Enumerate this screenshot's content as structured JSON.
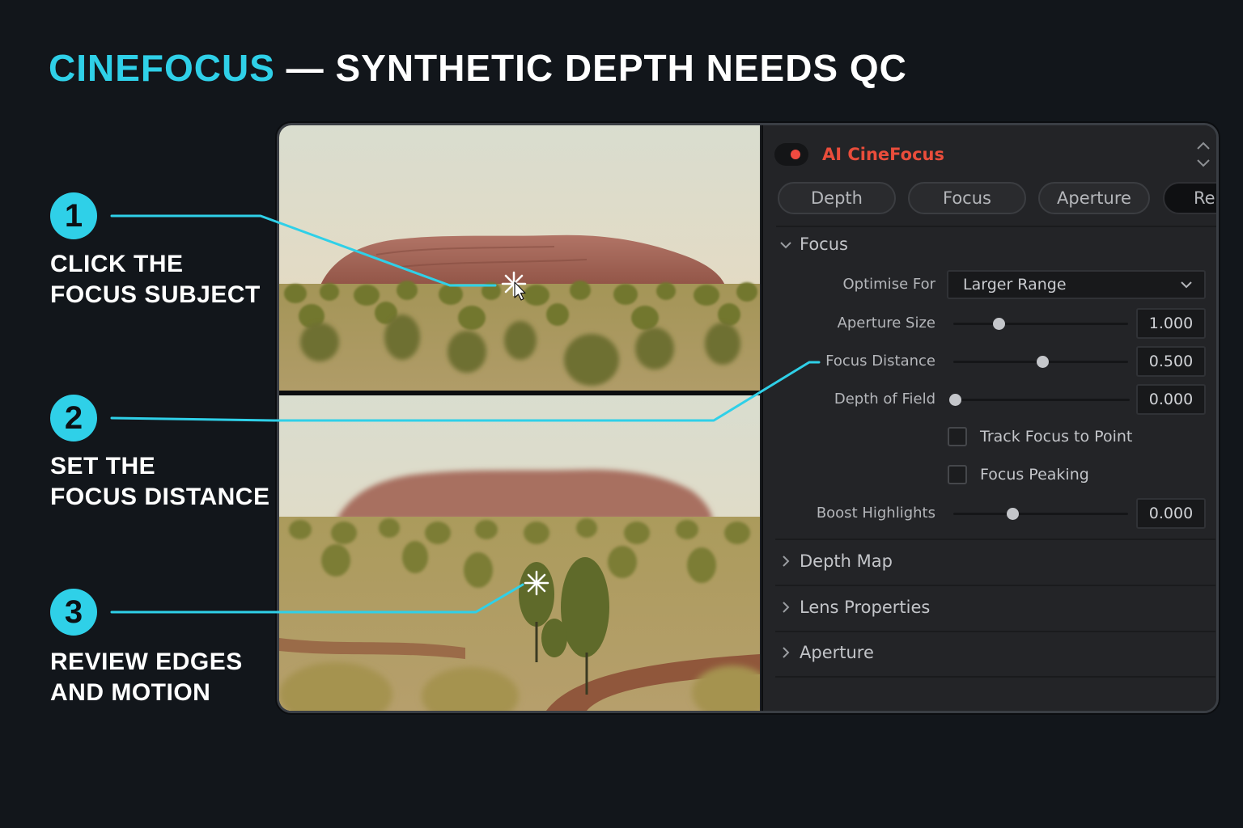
{
  "headline": {
    "brand": "CINEFOCUS",
    "rest": " — SYNTHETIC DEPTH NEEDS QC"
  },
  "steps": [
    {
      "number": "1",
      "line1": "CLICK THE",
      "line2": "FOCUS SUBJECT"
    },
    {
      "number": "2",
      "line1": "SET THE",
      "line2": "FOCUS DISTANCE"
    },
    {
      "number": "3",
      "line1": "REVIEW EDGES",
      "line2": "AND MOTION"
    }
  ],
  "colors": {
    "accent": "#2fd0e8",
    "plugin_title": "#ea4d3b",
    "panel_bg": "#232427",
    "page_bg": "#12161b"
  },
  "panel": {
    "title": "AI CineFocus",
    "enabled": true,
    "tabs": [
      {
        "label": "Depth",
        "active": false
      },
      {
        "label": "Focus",
        "active": false
      },
      {
        "label": "Aperture",
        "active": false
      },
      {
        "label": "Re",
        "active": true
      }
    ],
    "focus_section": {
      "title": "Focus",
      "expanded": true,
      "optimise_for": {
        "label": "Optimise For",
        "value": "Larger Range"
      },
      "sliders": [
        {
          "label": "Aperture Size",
          "value": "1.000",
          "position": 0.26
        },
        {
          "label": "Focus Distance",
          "value": "0.500",
          "position": 0.51
        },
        {
          "label": "Depth of Field",
          "value": "0.000",
          "position": 0.0
        }
      ],
      "checkboxes": [
        {
          "label": "Track Focus to Point",
          "checked": false
        },
        {
          "label": "Focus Peaking",
          "checked": false
        }
      ],
      "boost": {
        "label": "Boost Highlights",
        "value": "0.000",
        "position": 0.34
      }
    },
    "collapsed_sections": [
      {
        "title": "Depth Map"
      },
      {
        "title": "Lens Properties"
      },
      {
        "title": "Aperture"
      }
    ]
  },
  "icons": {
    "focus_marker": "asterisk-focus-icon",
    "cursor": "arrow-cursor-icon",
    "toggle": "power-toggle-icon",
    "updown": "up-down-chevron-icon",
    "expand": "chevron-down-icon",
    "collapse": "chevron-right-icon"
  }
}
